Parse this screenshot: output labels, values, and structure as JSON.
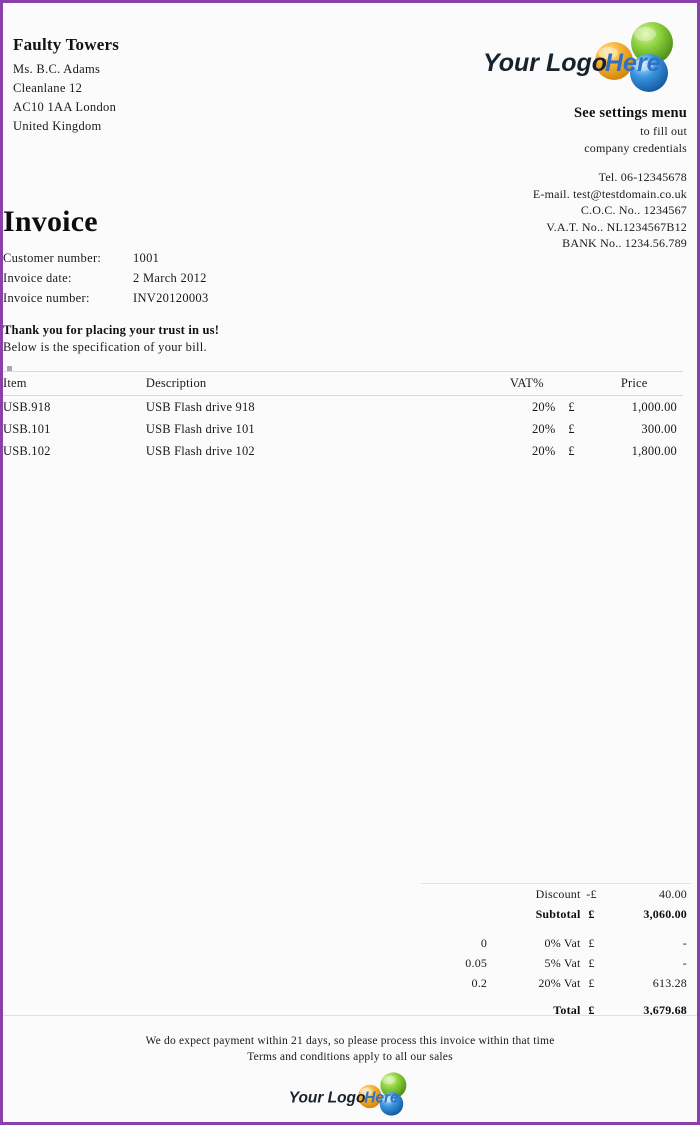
{
  "document": {
    "type": "invoice",
    "border_color": "#8b3fa8",
    "background_color": "#fcfbfc"
  },
  "customer_address": {
    "company": "Faulty Towers",
    "lines": [
      "Ms. B.C. Adams",
      "Cleanlane  12",
      "AC10 1AA  London",
      "United  Kingdom"
    ]
  },
  "logo": {
    "text_primary": "Your Logo",
    "text_accent": "Here",
    "primary_color": "#16232e",
    "accent_color": "#2f72c4",
    "sphere_green": "#7dc242",
    "sphere_orange": "#f5a623",
    "sphere_blue": "#2f8fd8",
    "name": "your-logo-here"
  },
  "settings_notice": {
    "title": "See settings menu",
    "sub_line_1": "to fill out",
    "sub_line_2": "company credentials"
  },
  "company_contact": {
    "lines": [
      "Tel. 06-12345678",
      "E-mail. test@testdomain.co.uk",
      "C.O.C. No.. 1234567",
      "V.A.T. No.. NL1234567B12",
      "BANK No.. 1234.56.789"
    ]
  },
  "invoice": {
    "title": "Invoice",
    "meta": [
      {
        "label": "Customer  number:",
        "value": "1001"
      },
      {
        "label": "Invoice  date:",
        "value": "2 March 2012"
      },
      {
        "label": "Invoice  number:",
        "value": "INV20120003"
      }
    ]
  },
  "intro": {
    "bold": "Thank you for placing your trust in us!",
    "sub": "Below  is the  specification  of your bill."
  },
  "items_table": {
    "headers": {
      "item": "Item",
      "description": "Description",
      "vat": "VAT%",
      "currency": "",
      "price": "Price"
    },
    "rows": [
      {
        "item": "USB.918",
        "description": "USB Flash drive 918",
        "vat": "20%",
        "currency": "£",
        "price": "1,000.00"
      },
      {
        "item": "USB.101",
        "description": "USB Flash drive 101",
        "vat": "20%",
        "currency": "£",
        "price": "300.00"
      },
      {
        "item": "USB.102",
        "description": "USB Flash drive 102",
        "vat": "20%",
        "currency": "£",
        "price": "1,800.00"
      }
    ]
  },
  "totals": {
    "discount": {
      "rate": "",
      "label": "Discount",
      "currency": "-£",
      "value": "40.00"
    },
    "subtotal": {
      "rate": "",
      "label": "Subtotal",
      "currency": "£",
      "value": "3,060.00"
    },
    "vat_rows": [
      {
        "rate": "0",
        "label": "0% Vat",
        "currency": "£",
        "value": "-"
      },
      {
        "rate": "0.05",
        "label": "5% Vat",
        "currency": "£",
        "value": "-"
      },
      {
        "rate": "0.2",
        "label": "20% Vat",
        "currency": "£",
        "value": "613.28"
      }
    ],
    "total": {
      "rate": "",
      "label": "Total",
      "currency": "£",
      "value": "3,679.68"
    }
  },
  "footer": {
    "line_1": "We do expect payment within  21 days, so please process this  invoice  within  that time",
    "line_2": "Terms and conditions  apply to all our  sales"
  }
}
